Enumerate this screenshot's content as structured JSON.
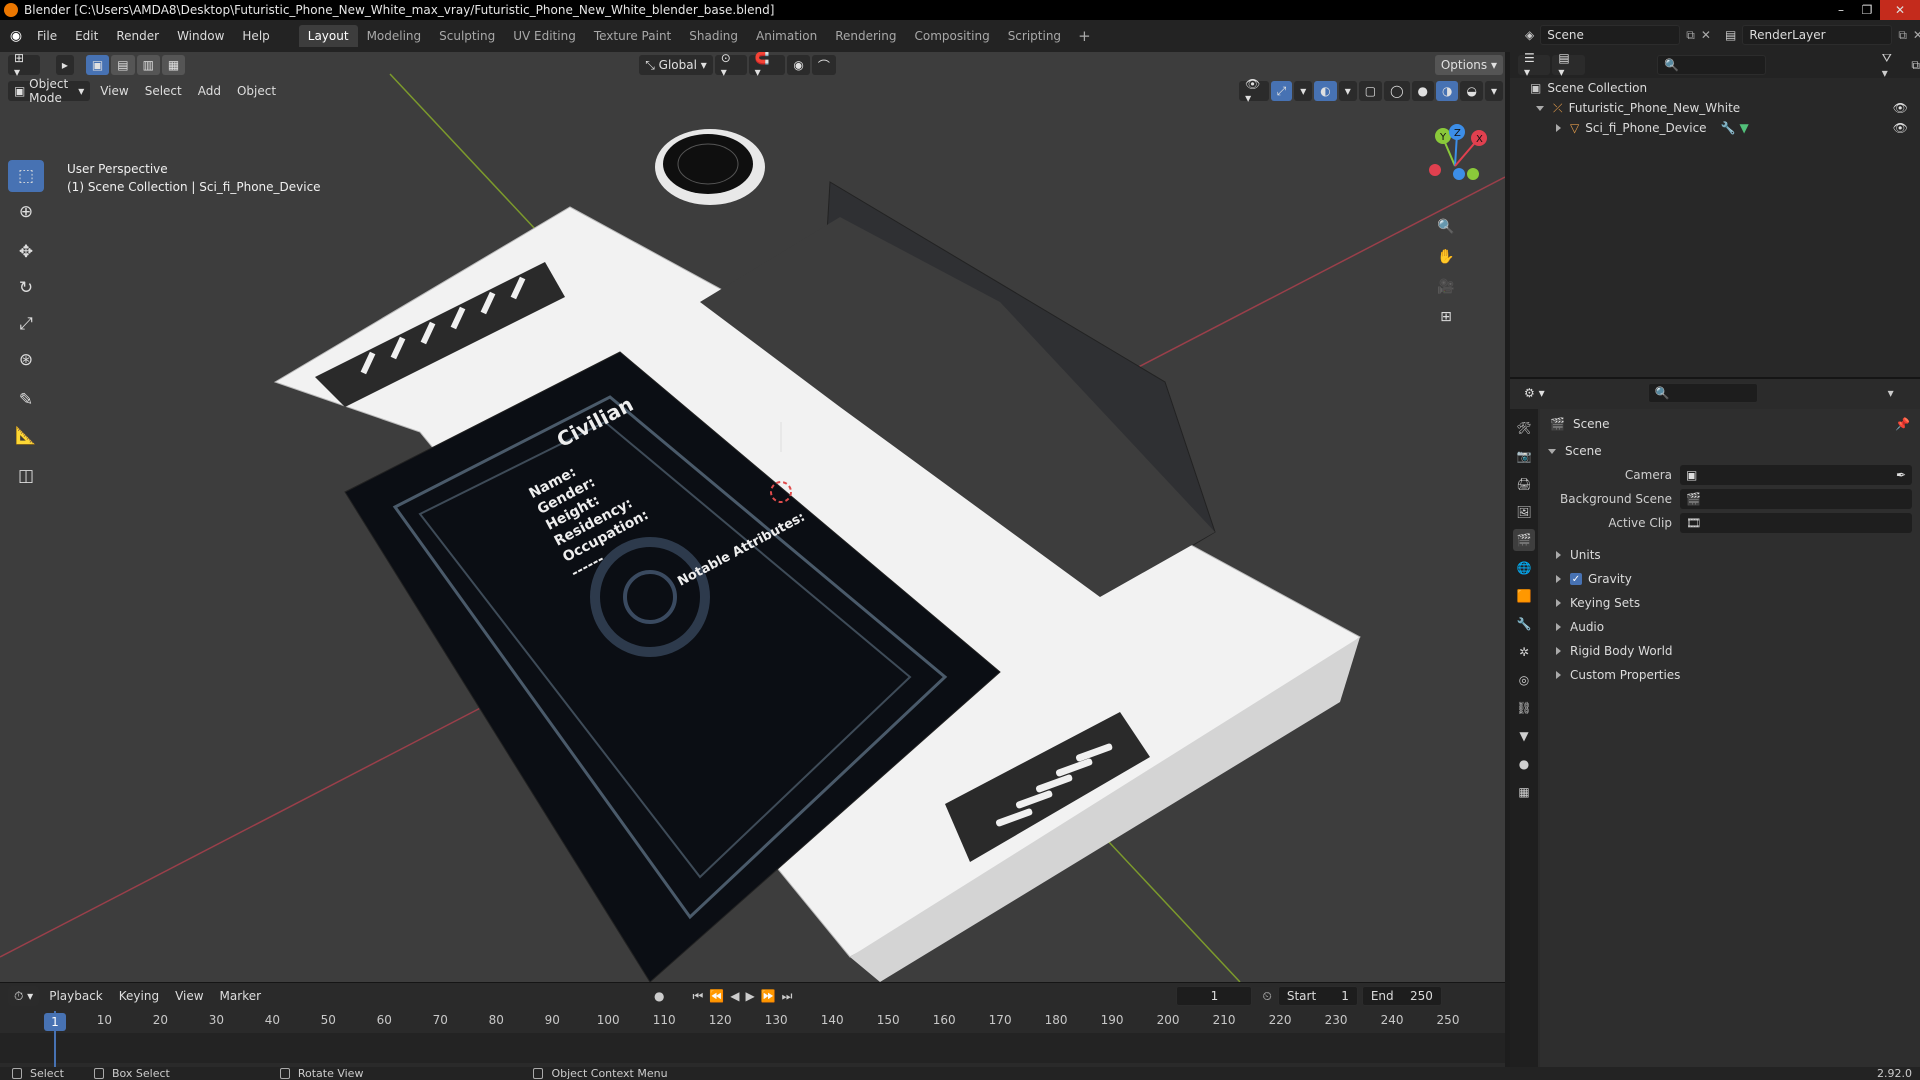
{
  "window": {
    "title": "Blender [C:\\Users\\AMDA8\\Desktop\\Futuristic_Phone_New_White_max_vray/Futuristic_Phone_New_White_blender_base.blend]"
  },
  "menu": [
    "File",
    "Edit",
    "Render",
    "Window",
    "Help"
  ],
  "workspaces": [
    "Layout",
    "Modeling",
    "Sculpting",
    "UV Editing",
    "Texture Paint",
    "Shading",
    "Animation",
    "Rendering",
    "Compositing",
    "Scripting"
  ],
  "active_workspace": "Layout",
  "topright": {
    "scene": "Scene",
    "view_layer": "RenderLayer"
  },
  "viewport": {
    "transform_orientation": "Global",
    "options_label": "Options",
    "mode": "Object Mode",
    "menus": [
      "View",
      "Select",
      "Add",
      "Object"
    ],
    "info_line1": "User Perspective",
    "info_line2": "(1) Scene Collection | Sci_fi_Phone_Device",
    "gizmo_labels": {
      "y": "Y",
      "z": "Z",
      "x": "X"
    }
  },
  "screen_texture": {
    "title": "Civilian",
    "fields": [
      "Name:",
      "Gender:",
      "Height:",
      "Residency:",
      "Occupation:"
    ],
    "dashes": "------",
    "notable": "Notable Attributes:"
  },
  "timeline": {
    "menus": [
      "Playback",
      "Keying",
      "View",
      "Marker"
    ],
    "current_frame": "1",
    "start_label": "Start",
    "start": "1",
    "end_label": "End",
    "end": "250",
    "ticks": [
      "1",
      "10",
      "20",
      "30",
      "40",
      "50",
      "60",
      "70",
      "80",
      "90",
      "100",
      "110",
      "120",
      "130",
      "140",
      "150",
      "160",
      "170",
      "180",
      "190",
      "200",
      "210",
      "220",
      "230",
      "240",
      "250"
    ]
  },
  "status": {
    "select": "Select",
    "box_select": "Box Select",
    "rotate_view": "Rotate View",
    "context_menu": "Object Context Menu",
    "version": "2.92.0"
  },
  "outliner": {
    "root": "Scene Collection",
    "collection": "Futuristic_Phone_New_White",
    "object": "Sci_fi_Phone_Device"
  },
  "properties": {
    "header": "Scene",
    "panel": "Scene",
    "camera_label": "Camera",
    "background_label": "Background Scene",
    "clip_label": "Active Clip",
    "subpanels": [
      "Units",
      "Gravity",
      "Keying Sets",
      "Audio",
      "Rigid Body World",
      "Custom Properties"
    ]
  },
  "colors": {
    "accent": "#4772b3",
    "axis_x": "#e0404f",
    "axis_y": "#8ac93a",
    "axis_z": "#3c8ee8",
    "viewport_bg": "#3d3d3d"
  }
}
